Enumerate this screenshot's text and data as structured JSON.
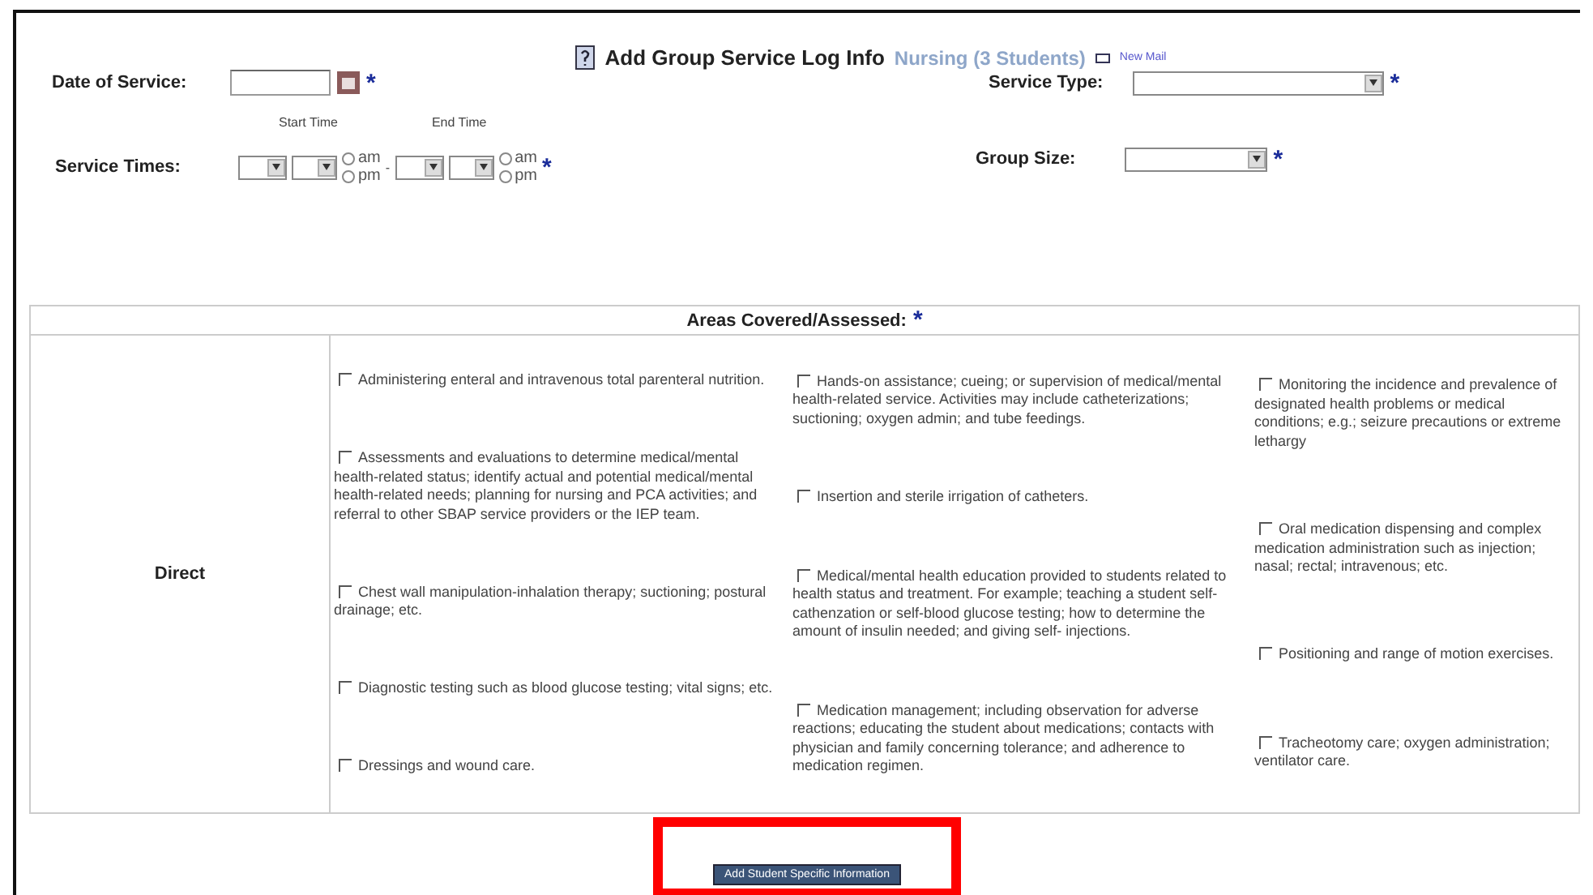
{
  "header": {
    "title": "Add Group Service Log Info",
    "subtitle": "Nursing (3 Students)",
    "mail_link": "New Mail"
  },
  "date_of_service": {
    "label": "Date of Service:",
    "required_mark": "*"
  },
  "service_type": {
    "label": "Service Type:",
    "required_mark": "*"
  },
  "time_headers": {
    "start": "Start Time",
    "end": "End Time"
  },
  "service_times": {
    "label": "Service Times:",
    "separator": "-",
    "required_mark": "*",
    "start_meridiem": [
      {
        "label": "am",
        "selected": false
      },
      {
        "label": "pm",
        "selected": false
      }
    ],
    "end_meridiem": [
      {
        "label": "am",
        "selected": false
      },
      {
        "label": "pm",
        "selected": false
      }
    ]
  },
  "group_size": {
    "label": "Group Size:",
    "required_mark": "*"
  },
  "areas": {
    "heading": "Areas Covered/Assessed:",
    "required_mark": "*",
    "row_label": "Direct",
    "columns": [
      [
        {
          "text": "Administering enteral and intravenous total parenteral nutrition.",
          "checked": false
        },
        {
          "text": "Assessments and evaluations to determine medical/mental health-related status; identify actual and potential medical/mental health-related needs; planning for nursing and PCA activities; and referral to other SBAP service providers or the IEP team.",
          "checked": false
        },
        {
          "text": "Chest wall manipulation-inhalation therapy; suctioning; postural drainage; etc.",
          "checked": false
        },
        {
          "text": "Diagnostic testing such as blood glucose testing; vital signs; etc.",
          "checked": false
        },
        {
          "text": "Dressings and wound care.",
          "checked": false
        }
      ],
      [
        {
          "text": "Hands-on assistance; cueing; or supervision of medical/mental health-related service. Activities may include catheterizations; suctioning; oxygen admin; and tube feedings.",
          "checked": false
        },
        {
          "text": "Insertion and sterile irrigation of catheters.",
          "checked": false
        },
        {
          "text": "Medical/mental health education provided to students related to health status and treatment. For example; teaching a student self-cathenzation or self-blood glucose testing; how to determine the amount of insulin needed; and giving self- injections.",
          "checked": false
        },
        {
          "text": "Medication management; including observation for adverse reactions; educating the student about medications; contacts with physician and family concerning tolerance; and adherence to medication regimen.",
          "checked": false
        }
      ],
      [
        {
          "text": "Monitoring the incidence and prevalence of designated health problems or medical conditions; e.g.; seizure precautions or extreme lethargy",
          "checked": false
        },
        {
          "text": "Oral medication dispensing and complex medication administration such as injection; nasal; rectal; intravenous; etc.",
          "checked": false
        },
        {
          "text": "Positioning and range of motion exercises.",
          "checked": false
        },
        {
          "text": "Tracheotomy care; oxygen administration; ventilator care.",
          "checked": false
        }
      ]
    ]
  },
  "submit_button": {
    "label": "Add Student Specific Information",
    "highlighted": true
  }
}
